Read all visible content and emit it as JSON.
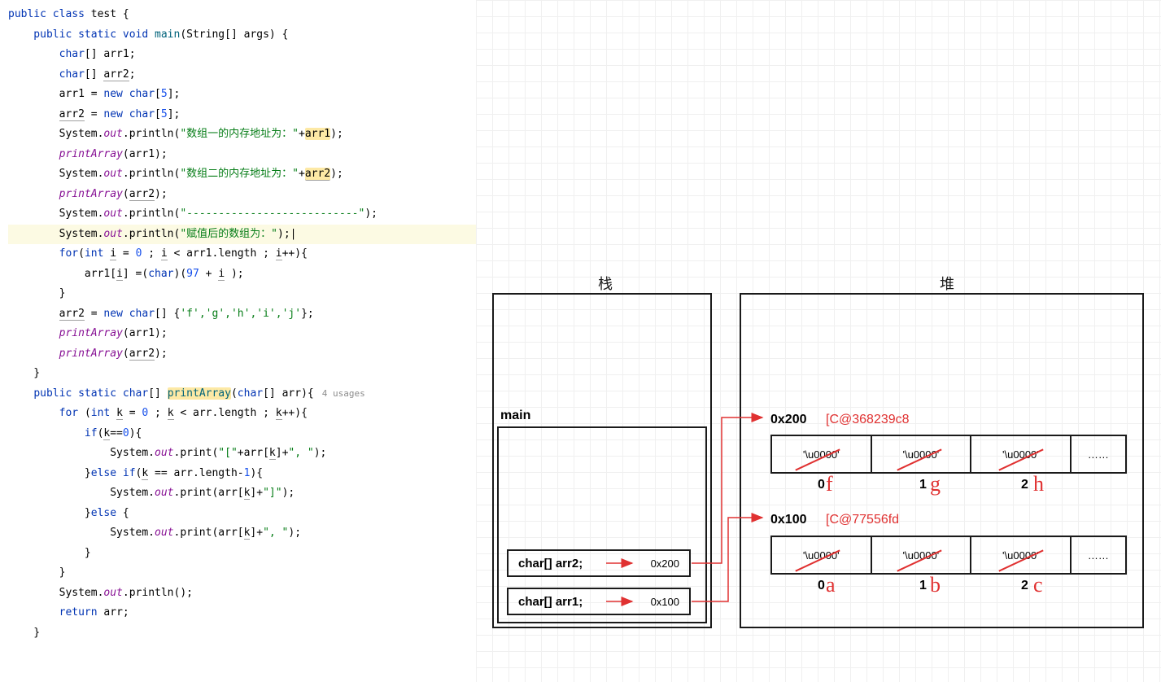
{
  "code": {
    "l1_public": "public ",
    "l1_class": "class ",
    "l1_name": "test ",
    "l1_brace": "{",
    "l2": "    public static void ",
    "l2m": "main",
    "l2p": "(String[] args) {",
    "l3a": "        char",
    "l3b": "[] arr1;",
    "l4a": "        char",
    "l4b": "[] ",
    "l4c": "arr2",
    "l4d": ";",
    "l5a": "        arr1 = ",
    "l5b": "new char",
    "l5c": "[",
    "l5n": "5",
    "l5d": "];",
    "l6a": "        ",
    "l6b": "arr2",
    "l6c": " = ",
    "l6d": "new char",
    "l6e": "[",
    "l6n": "5",
    "l6f": "];",
    "l7a": "        System.",
    "l7out": "out",
    "l7b": ".println(",
    "l7s": "\"数组一的内存地址为：\"",
    "l7c": "+",
    "l7d": "arr1",
    "l7e": ");",
    "l8a": "        ",
    "l8m": "printArray",
    "l8b": "(arr1);",
    "l9a": "        System.",
    "l9out": "out",
    "l9b": ".println(",
    "l9s": "\"数组二的内存地址为：\"",
    "l9c": "+",
    "l9d": "arr2",
    "l9e": ");",
    "l10a": "        ",
    "l10m": "printArray",
    "l10b": "(",
    "l10c": "arr2",
    "l10d": ");",
    "blank": "",
    "l12a": "        System.",
    "l12out": "out",
    "l12b": ".println(",
    "l12s": "\"---------------------------\"",
    "l12c": ");",
    "l13a": "        System.",
    "l13out": "out",
    "l13b": ".println(",
    "l13s": "\"赋值后的数组为：\"",
    "l13c": ");",
    "l13caret": "|",
    "l14a": "        ",
    "l14for": "for",
    "l14b": "(",
    "l14int": "int ",
    "l14i": "i",
    "l14c": " = ",
    "l14z": "0",
    "l14d": " ; ",
    "l14i2": "i",
    "l14e": " < arr1.length ; ",
    "l14i3": "i",
    "l14f": "++){",
    "l15a": "            arr1[",
    "l15i": "i",
    "l15b": "] =(",
    "l15char": "char",
    "l15c": ")(",
    "l15n": "97",
    "l15d": " + ",
    "l15i2": "i",
    "l15e": " );",
    "l16": "        }",
    "l17a": "        ",
    "l17b": "arr2",
    "l17c": " = ",
    "l17new": "new char",
    "l17d": "[] {",
    "l17s": "'f','g','h','i','j'",
    "l17e": "};",
    "l18a": "        ",
    "l18m": "printArray",
    "l18b": "(arr1);",
    "l19a": "        ",
    "l19m": "printArray",
    "l19b": "(",
    "l19c": "arr2",
    "l19d": ");",
    "l20": "    }",
    "l22a": "    ",
    "l22pub": "public static ",
    "l22ret": "char",
    "l22b": "[] ",
    "l22m": "printArray",
    "l22c": "(",
    "l22t": "char",
    "l22d": "[] arr){",
    "l22u": "4 usages",
    "l23a": "        ",
    "l23for": "for ",
    "l23b": "(",
    "l23int": "int ",
    "l23k": "k",
    "l23c": " = ",
    "l23z": "0",
    "l23d": " ; ",
    "l23k2": "k",
    "l23e": " < arr.length ; ",
    "l23k3": "k",
    "l23f": "++){",
    "l24a": "            ",
    "l24if": "if",
    "l24b": "(",
    "l24k": "k",
    "l24c": "==",
    "l24z": "0",
    "l24d": "){",
    "l25a": "                System.",
    "l25out": "out",
    "l25b": ".print(",
    "l25s1": "\"[\"",
    "l25c": "+arr[",
    "l25k": "k",
    "l25d": "]+",
    "l25s2": "\", \"",
    "l25e": ");",
    "l26a": "            }",
    "l26else": "else if",
    "l26b": "(",
    "l26k": "k",
    "l26c": " == arr.length-",
    "l26n": "1",
    "l26d": "){",
    "l27a": "                System.",
    "l27out": "out",
    "l27b": ".print(arr[",
    "l27k": "k",
    "l27c": "]+",
    "l27s": "\"]\"",
    "l27d": ");",
    "l28a": "            }",
    "l28else": "else ",
    "l28b": "{",
    "l29a": "                System.",
    "l29out": "out",
    "l29b": ".print(arr[",
    "l29k": "k",
    "l29c": "]+",
    "l29s": "\", \"",
    "l29d": ");",
    "l30": "            }",
    "l31": "        }",
    "l32a": "        System.",
    "l32out": "out",
    "l32b": ".println();",
    "l33a": "        ",
    "l33ret": "return ",
    "l33b": "arr;",
    "l34": "    }"
  },
  "diagram": {
    "stack_title": "栈",
    "heap_title": "堆",
    "main_label": "main",
    "arr2_decl": "char[] arr2;",
    "arr2_addr": "0x200",
    "arr1_decl": "char[] arr1;",
    "arr1_addr": "0x100",
    "heap_addr_200": "0x200",
    "heap_ref_200": "[C@368239c8",
    "heap_addr_100": "0x100",
    "heap_ref_100": "[C@77556fd",
    "cell_val": "'\\u0000'",
    "ellipsis": "……",
    "idx0": "0",
    "idx1": "1",
    "idx2": "2",
    "h_f": "f",
    "h_g": "g",
    "h_h": "h",
    "h_a": "a",
    "h_b": "b",
    "h_c": "c"
  }
}
